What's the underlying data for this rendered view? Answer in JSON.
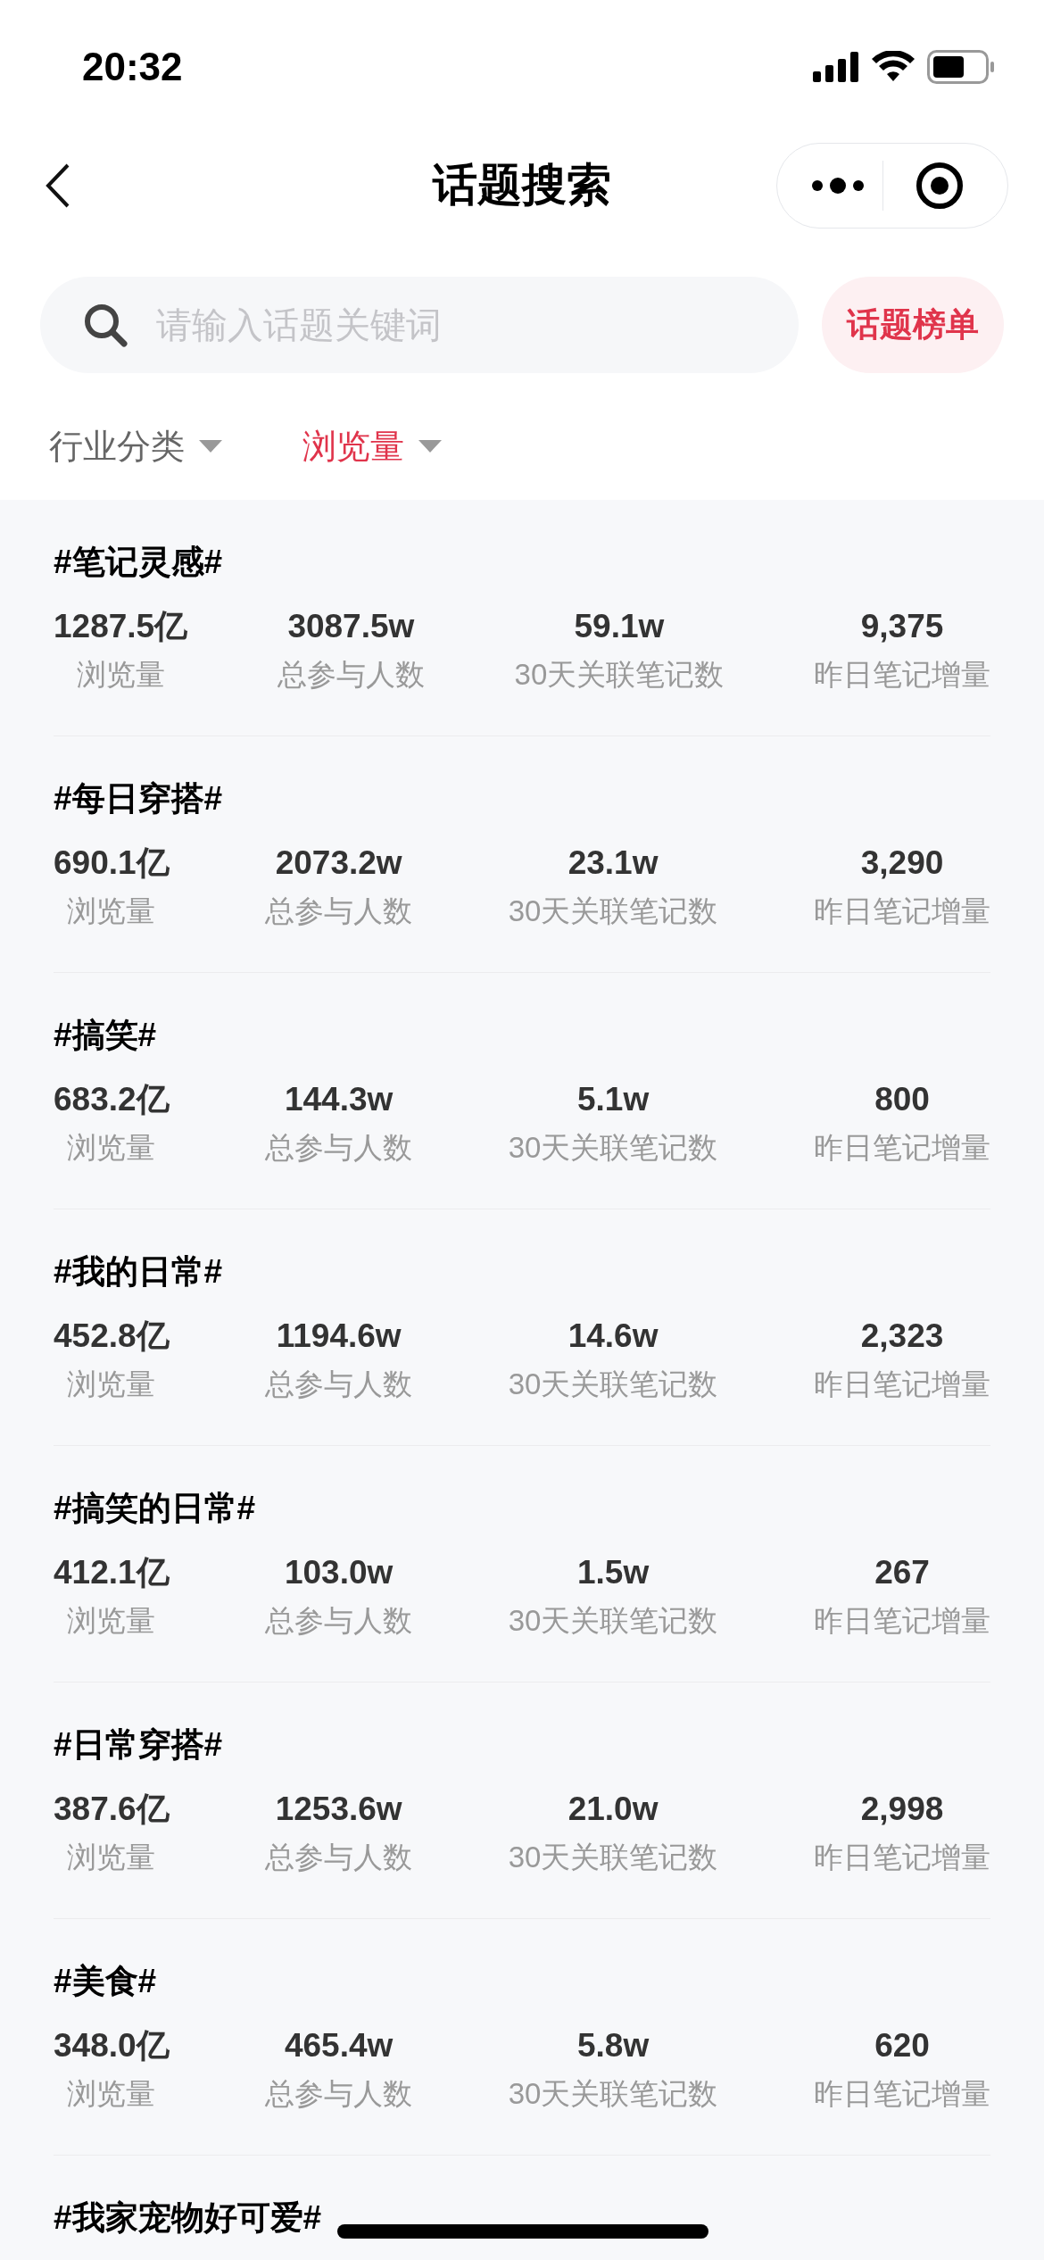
{
  "status_bar": {
    "time": "20:32"
  },
  "nav": {
    "title": "话题搜索"
  },
  "search": {
    "placeholder": "请输入话题关键词",
    "button": "话题榜单"
  },
  "filters": [
    {
      "label": "行业分类",
      "selected": false
    },
    {
      "label": "浏览量",
      "selected": true
    }
  ],
  "topics": [
    {
      "title": "#笔记灵感#",
      "stats": [
        {
          "value": "1287.5亿",
          "label": "浏览量"
        },
        {
          "value": "3087.5w",
          "label": "总参与人数"
        },
        {
          "value": "59.1w",
          "label": "30天关联笔记数"
        },
        {
          "value": "9,375",
          "label": "昨日笔记增量"
        }
      ]
    },
    {
      "title": "#每日穿搭#",
      "stats": [
        {
          "value": "690.1亿",
          "label": "浏览量"
        },
        {
          "value": "2073.2w",
          "label": "总参与人数"
        },
        {
          "value": "23.1w",
          "label": "30天关联笔记数"
        },
        {
          "value": "3,290",
          "label": "昨日笔记增量"
        }
      ]
    },
    {
      "title": "#搞笑#",
      "stats": [
        {
          "value": "683.2亿",
          "label": "浏览量"
        },
        {
          "value": "144.3w",
          "label": "总参与人数"
        },
        {
          "value": "5.1w",
          "label": "30天关联笔记数"
        },
        {
          "value": "800",
          "label": "昨日笔记增量"
        }
      ]
    },
    {
      "title": "#我的日常#",
      "stats": [
        {
          "value": "452.8亿",
          "label": "浏览量"
        },
        {
          "value": "1194.6w",
          "label": "总参与人数"
        },
        {
          "value": "14.6w",
          "label": "30天关联笔记数"
        },
        {
          "value": "2,323",
          "label": "昨日笔记增量"
        }
      ]
    },
    {
      "title": "#搞笑的日常#",
      "stats": [
        {
          "value": "412.1亿",
          "label": "浏览量"
        },
        {
          "value": "103.0w",
          "label": "总参与人数"
        },
        {
          "value": "1.5w",
          "label": "30天关联笔记数"
        },
        {
          "value": "267",
          "label": "昨日笔记增量"
        }
      ]
    },
    {
      "title": "#日常穿搭#",
      "stats": [
        {
          "value": "387.6亿",
          "label": "浏览量"
        },
        {
          "value": "1253.6w",
          "label": "总参与人数"
        },
        {
          "value": "21.0w",
          "label": "30天关联笔记数"
        },
        {
          "value": "2,998",
          "label": "昨日笔记增量"
        }
      ]
    },
    {
      "title": "#美食#",
      "stats": [
        {
          "value": "348.0亿",
          "label": "浏览量"
        },
        {
          "value": "465.4w",
          "label": "总参与人数"
        },
        {
          "value": "5.8w",
          "label": "30天关联笔记数"
        },
        {
          "value": "620",
          "label": "昨日笔记增量"
        }
      ]
    },
    {
      "title": "#我家宠物好可爱#"
    }
  ]
}
